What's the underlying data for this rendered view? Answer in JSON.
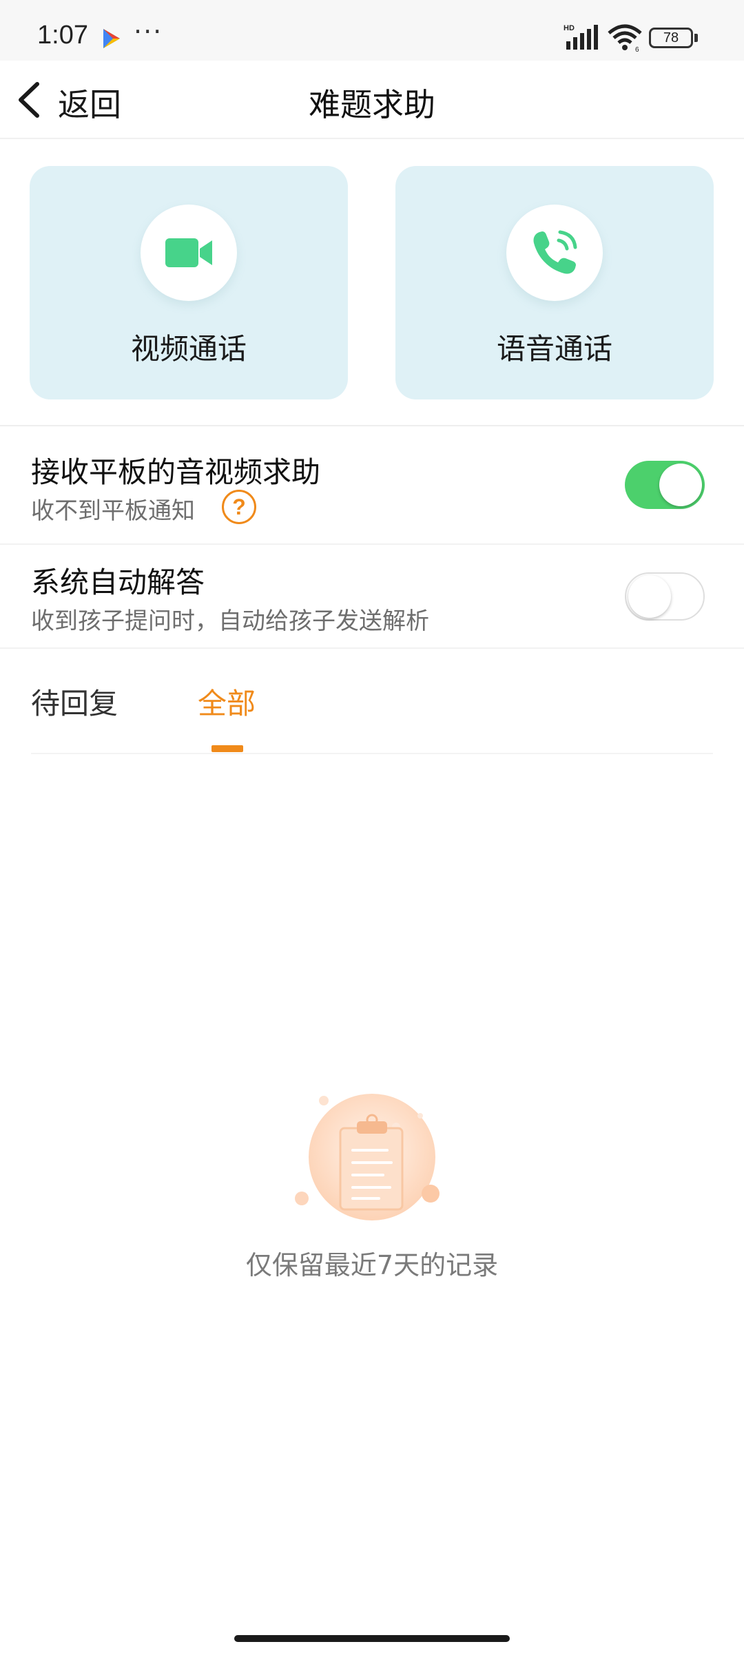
{
  "status_bar": {
    "time": "1:07",
    "more": "···",
    "battery": "78",
    "icons": [
      "play-store-icon",
      "hd-signal-icon",
      "wifi-icon",
      "battery-icon"
    ]
  },
  "nav": {
    "back_label": "返回",
    "title": "难题求助"
  },
  "calls": {
    "video_label": "视频通话",
    "voice_label": "语音通话"
  },
  "settings": {
    "tablet_help": {
      "title": "接收平板的音视频求助",
      "subtitle": "收不到平板通知",
      "help_icon_text": "?",
      "enabled": true
    },
    "auto_answer": {
      "title": "系统自动解答",
      "subtitle": "收到孩子提问时，自动给孩子发送解析",
      "enabled": false
    }
  },
  "tabs": [
    {
      "label": "待回复",
      "active": false
    },
    {
      "label": "全部",
      "active": true
    }
  ],
  "empty_state": {
    "message": "仅保留最近7天的记录"
  },
  "colors": {
    "accent": "#f08a1a",
    "toggle_on": "#4cd06c",
    "card_bg": "#dff1f6",
    "icon_green": "#47d38a"
  }
}
